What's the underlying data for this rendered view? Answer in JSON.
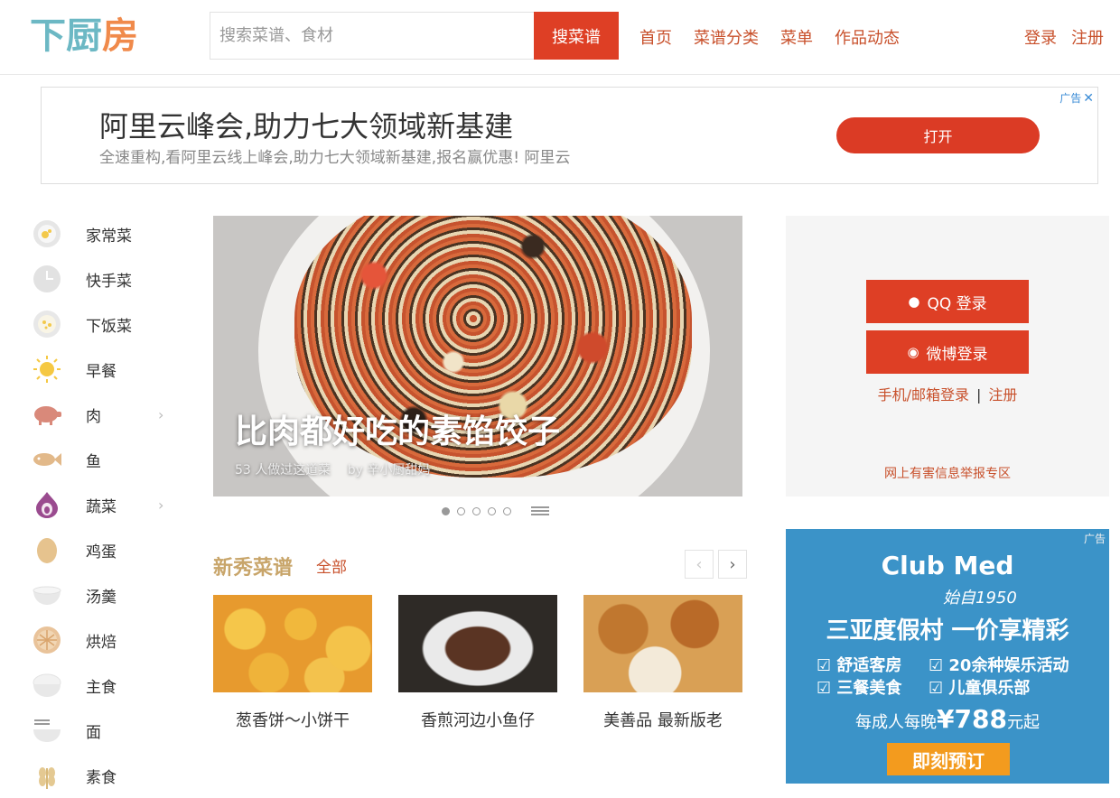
{
  "header": {
    "logo": [
      "下",
      "厨",
      "房"
    ],
    "search_placeholder": "搜索菜谱、食材",
    "search_button": "搜菜谱",
    "nav": [
      "首页",
      "菜谱分类",
      "菜单",
      "作品动态"
    ],
    "login": "登录",
    "register": "注册"
  },
  "top_ad": {
    "title": "阿里云峰会,助力七大领域新基建",
    "desc": "全速重构,看阿里云线上峰会,助力七大领域新基建,报名赢优惠! 阿里云",
    "button": "打开",
    "mark": "广告",
    "close": "✕"
  },
  "sidebar": {
    "items": [
      {
        "label": "家常菜",
        "icon": "egg-plate-icon"
      },
      {
        "label": "快手菜",
        "icon": "clock-icon"
      },
      {
        "label": "下饭菜",
        "icon": "rice-bowl-icon"
      },
      {
        "label": "早餐",
        "icon": "sun-icon"
      },
      {
        "label": "肉",
        "icon": "pig-icon",
        "arrow": "›"
      },
      {
        "label": "鱼",
        "icon": "fish-icon"
      },
      {
        "label": "蔬菜",
        "icon": "onion-icon",
        "arrow": "›"
      },
      {
        "label": "鸡蛋",
        "icon": "egg-icon"
      },
      {
        "label": "汤羹",
        "icon": "soup-bowl-icon"
      },
      {
        "label": "烘焙",
        "icon": "pie-icon"
      },
      {
        "label": "主食",
        "icon": "rice-icon"
      },
      {
        "label": "面",
        "icon": "noodle-icon"
      },
      {
        "label": "素食",
        "icon": "wheat-icon"
      }
    ]
  },
  "hero": {
    "title": "比肉都好吃的素馅饺子",
    "made_count": "53 人做过这道菜",
    "author": "by 辛小厨甜妈"
  },
  "new_recipes": {
    "title": "新秀菜谱",
    "all": "全部",
    "prev": "‹",
    "next": "›",
    "items": [
      "葱香饼～小饼干",
      "香煎河边小鱼仔",
      "美善品 最新版老"
    ]
  },
  "login_box": {
    "qq": "QQ 登录",
    "weibo": "微博登录",
    "phone_login": "手机/邮箱登录",
    "sep": "|",
    "register": "注册",
    "report": "网上有害信息举报专区"
  },
  "side_ad": {
    "brand": "Club Med",
    "since": "始自1950",
    "slogan": "三亚度假村 一价享精彩",
    "features": [
      "☑ 舒适客房",
      "☑ 20余种娱乐活动",
      "☑ 三餐美食",
      "☑ 儿童俱乐部"
    ],
    "price_prefix": "每成人每晚",
    "price": "¥788",
    "price_suffix": "元起",
    "button": "即刻预订",
    "mark": "广告"
  },
  "colors": {
    "accent": "#de3f25",
    "link": "#c8502b",
    "section": "#c8a56a",
    "ad_blue": "#3b93c8"
  }
}
